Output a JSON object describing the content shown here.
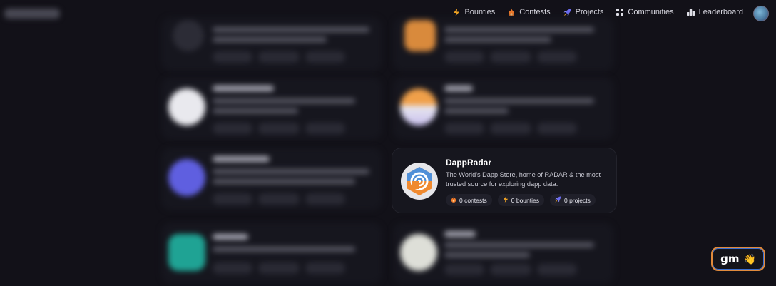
{
  "nav": {
    "items": [
      {
        "label": "Bounties",
        "icon": "lightning-icon",
        "color": "#f5a623"
      },
      {
        "label": "Contests",
        "icon": "flame-icon",
        "color": "#f07a2a"
      },
      {
        "label": "Projects",
        "icon": "rocket-icon",
        "color": "#6c6cf0"
      },
      {
        "label": "Communities",
        "icon": "grid-icon",
        "color": "#e0e0e8"
      },
      {
        "label": "Leaderboard",
        "icon": "podium-icon",
        "color": "#e0e0e8"
      }
    ]
  },
  "featured": {
    "name": "DappRadar",
    "description": "The World's Dapp Store, home of RADAR & the most trusted source for exploring dapp data.",
    "stats": {
      "contests": "0 contests",
      "bounties": "0 bounties",
      "projects": "0 projects"
    }
  },
  "gm_button": {
    "label": "gm",
    "emoji": "👋"
  },
  "colors": {
    "background": "#121118",
    "card": "#16161e",
    "accent_orange": "#e08a3c",
    "accent_blue": "#3a6fd0"
  }
}
